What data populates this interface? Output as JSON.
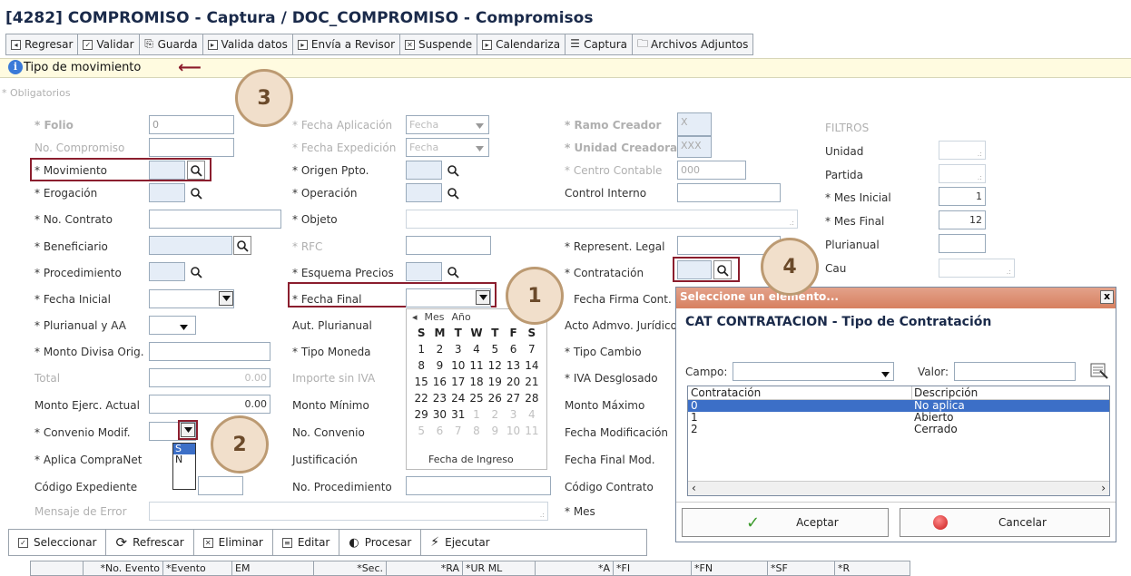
{
  "window": {
    "title": "[4282]  COMPROMISO - Captura / DOC_COMPROMISO - Compromisos"
  },
  "toolbar": [
    {
      "label": "Regresar",
      "icon": "back-icon"
    },
    {
      "label": "Validar",
      "icon": "check-icon"
    },
    {
      "label": "Guarda",
      "icon": "save-icon"
    },
    {
      "label": "Valida datos",
      "icon": "play-icon"
    },
    {
      "label": "Envía a Revisor",
      "icon": "play-icon"
    },
    {
      "label": "Suspende",
      "icon": "x-box-icon"
    },
    {
      "label": "Calendariza",
      "icon": "play-icon"
    },
    {
      "label": "Captura",
      "icon": "grid-icon"
    },
    {
      "label": "Archivos Adjuntos",
      "icon": "folder-icon"
    }
  ],
  "movement_bar": {
    "text": "Tipo de movimiento"
  },
  "required_note": "* Obligatorios",
  "col1": {
    "folio": {
      "label": "* Folio",
      "value": "0"
    },
    "no_compromiso": {
      "label": "No. Compromiso"
    },
    "movimiento": {
      "label": "* Movimiento"
    },
    "erogacion": {
      "label": "* Erogación"
    },
    "no_contrato": {
      "label": "* No. Contrato"
    },
    "beneficiario": {
      "label": "* Beneficiario"
    },
    "procedimiento": {
      "label": "* Procedimiento"
    },
    "fecha_inicial": {
      "label": "* Fecha Inicial"
    },
    "plurianual_aa": {
      "label": "* Plurianual y AA"
    },
    "monto_divisa": {
      "label": "* Monto Divisa Orig."
    },
    "total": {
      "label": "Total",
      "value": "0.00"
    },
    "monto_ejerc": {
      "label": "Monto Ejerc. Actual",
      "value": "0.00"
    },
    "convenio_modif": {
      "label": "* Convenio Modif."
    },
    "aplica_compranet": {
      "label": "* Aplica CompraNet"
    },
    "codigo_expediente": {
      "label": "Código Expediente"
    },
    "mensaje_error": {
      "label": "Mensaje de Error"
    }
  },
  "convenio_options": [
    "S",
    "N"
  ],
  "col2": {
    "fecha_aplicacion": {
      "label": "* Fecha Aplicación",
      "value": "Fecha"
    },
    "fecha_expedicion": {
      "label": "* Fecha Expedición",
      "value": "Fecha"
    },
    "origen_ppto": {
      "label": "* Origen Ppto."
    },
    "operacion": {
      "label": "* Operación"
    },
    "objeto": {
      "label": "* Objeto"
    },
    "rfc": {
      "label": "* RFC"
    },
    "esquema_precios": {
      "label": "* Esquema Precios"
    },
    "fecha_final": {
      "label": "* Fecha Final"
    },
    "aut_plurianual": {
      "label": "Aut. Plurianual"
    },
    "tipo_moneda": {
      "label": "* Tipo Moneda"
    },
    "importe_sin_iva": {
      "label": "Importe sin IVA"
    },
    "monto_minimo": {
      "label": "Monto Mínimo"
    },
    "no_convenio": {
      "label": "No. Convenio"
    },
    "justificacion": {
      "label": "Justificación"
    },
    "no_procedimiento": {
      "label": "No. Procedimiento"
    }
  },
  "col3": {
    "ramo_creador": {
      "label": "* Ramo Creador",
      "value": "X"
    },
    "unidad_creadora": {
      "label": "* Unidad Creadora",
      "value": "XXX"
    },
    "centro_contable": {
      "label": "* Centro Contable",
      "value": "000"
    },
    "control_interno": {
      "label": "Control Interno"
    },
    "represent_legal": {
      "label": "* Represent. Legal"
    },
    "contratacion": {
      "label": "* Contratación"
    },
    "fecha_firma": {
      "label": "Fecha Firma Cont."
    },
    "acto_admvo": {
      "label": "Acto Admvo. Jurídico"
    },
    "tipo_cambio": {
      "label": "* Tipo Cambio"
    },
    "iva_desglosado": {
      "label": "* IVA Desglosado"
    },
    "monto_maximo": {
      "label": "Monto Máximo"
    },
    "fecha_modificacion": {
      "label": "Fecha Modificación"
    },
    "fecha_final_mod": {
      "label": "Fecha Final Mod."
    },
    "codigo_contrato": {
      "label": "Código Contrato"
    },
    "mes": {
      "label": "* Mes"
    }
  },
  "filtros": {
    "title": "FILTROS",
    "unidad": {
      "label": "Unidad"
    },
    "partida": {
      "label": "Partida"
    },
    "mes_inicial": {
      "label": "* Mes Inicial",
      "value": "1"
    },
    "mes_final": {
      "label": "* Mes Final",
      "value": "12"
    },
    "plurianual": {
      "label": "Plurianual"
    },
    "cau": {
      "label": "Cau"
    }
  },
  "calendar": {
    "nav": {
      "prev": "◂",
      "month": "Mes",
      "year": "Año"
    },
    "weekdays": [
      "S",
      "M",
      "T",
      "W",
      "T",
      "F",
      "S"
    ],
    "weeks": [
      [
        "1",
        "2",
        "3",
        "4",
        "5",
        "6",
        "7"
      ],
      [
        "8",
        "9",
        "10",
        "11",
        "12",
        "13",
        "14"
      ],
      [
        "15",
        "16",
        "17",
        "18",
        "19",
        "20",
        "21"
      ],
      [
        "22",
        "23",
        "24",
        "25",
        "26",
        "27",
        "28"
      ],
      [
        "29",
        "30",
        "31",
        "1",
        "2",
        "3",
        "4"
      ],
      [
        "5",
        "6",
        "7",
        "8",
        "9",
        "10",
        "11"
      ]
    ],
    "footer": "Fecha de Ingreso"
  },
  "dialog": {
    "title": "Seleccione un elemento...",
    "close": "x",
    "heading": "CAT  CONTRATACION - Tipo de Contratación",
    "campo_label": "Campo:",
    "valor_label": "Valor:",
    "columns": [
      "Contratación",
      "Descripción"
    ],
    "rows": [
      {
        "code": "0",
        "desc": "No aplica"
      },
      {
        "code": "1",
        "desc": "Abierto"
      },
      {
        "code": "2",
        "desc": "Cerrado"
      }
    ],
    "accept": "Aceptar",
    "cancel": "Cancelar"
  },
  "bottom_toolbar": [
    {
      "label": "Seleccionar"
    },
    {
      "label": "Refrescar"
    },
    {
      "label": "Eliminar"
    },
    {
      "label": "Editar"
    },
    {
      "label": "Procesar"
    },
    {
      "label": "Ejecutar"
    }
  ],
  "grid_headers": [
    "*No. Evento",
    "*Evento",
    "EM",
    "*Sec.",
    "*RA",
    "*UR ML",
    "*A",
    "*FI",
    "*FN",
    "*SF",
    "*R"
  ],
  "callouts": [
    "1",
    "2",
    "3",
    "4"
  ],
  "colors": {
    "callout_border": "#bc9a72",
    "callout_fill": "#f1dfcb",
    "highlight_box": "#8b1e2e",
    "selected_row": "#3c6fc7"
  }
}
